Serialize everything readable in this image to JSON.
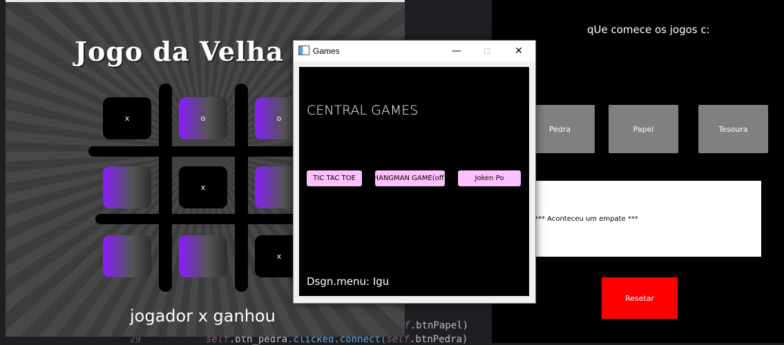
{
  "ide": {
    "line_number": "29",
    "code_line1": {
      "self": "self",
      "rest": ".btnPapel)"
    },
    "code_line2": {
      "self1": "self",
      "attr": ".btn_pedra",
      "method": ".clicked.connect(",
      "self2": "self",
      "rest": ".btnPedra)"
    }
  },
  "tictactoe": {
    "title": "Jogo da Velha",
    "cells": [
      "x",
      "o",
      "o",
      "",
      "x",
      "",
      "",
      "",
      "x"
    ],
    "status": "jogador x ganhou"
  },
  "rps": {
    "heading": "qUe comece os jogos c:",
    "buttons": {
      "rock": "Pedra",
      "paper": "Papel",
      "scissors": "Tesoura"
    },
    "result": "*** Aconteceu um empate ***",
    "reset": "Resetar",
    "colors": {
      "button": "#808080",
      "reset": "#ff0000"
    }
  },
  "games": {
    "window_title": "Games",
    "controls": {
      "minimize": "—",
      "maximize": "☐",
      "close": "✕"
    },
    "heading": "CENTRAL GAMES",
    "buttons": {
      "tictactoe": "TIC TAC TOE",
      "hangman": "HANGMAN GAME(off)",
      "jokenpo": "Joken Po"
    },
    "credit": "Dsgn.menu: Igu",
    "colors": {
      "button": "#ffc0ff"
    }
  }
}
